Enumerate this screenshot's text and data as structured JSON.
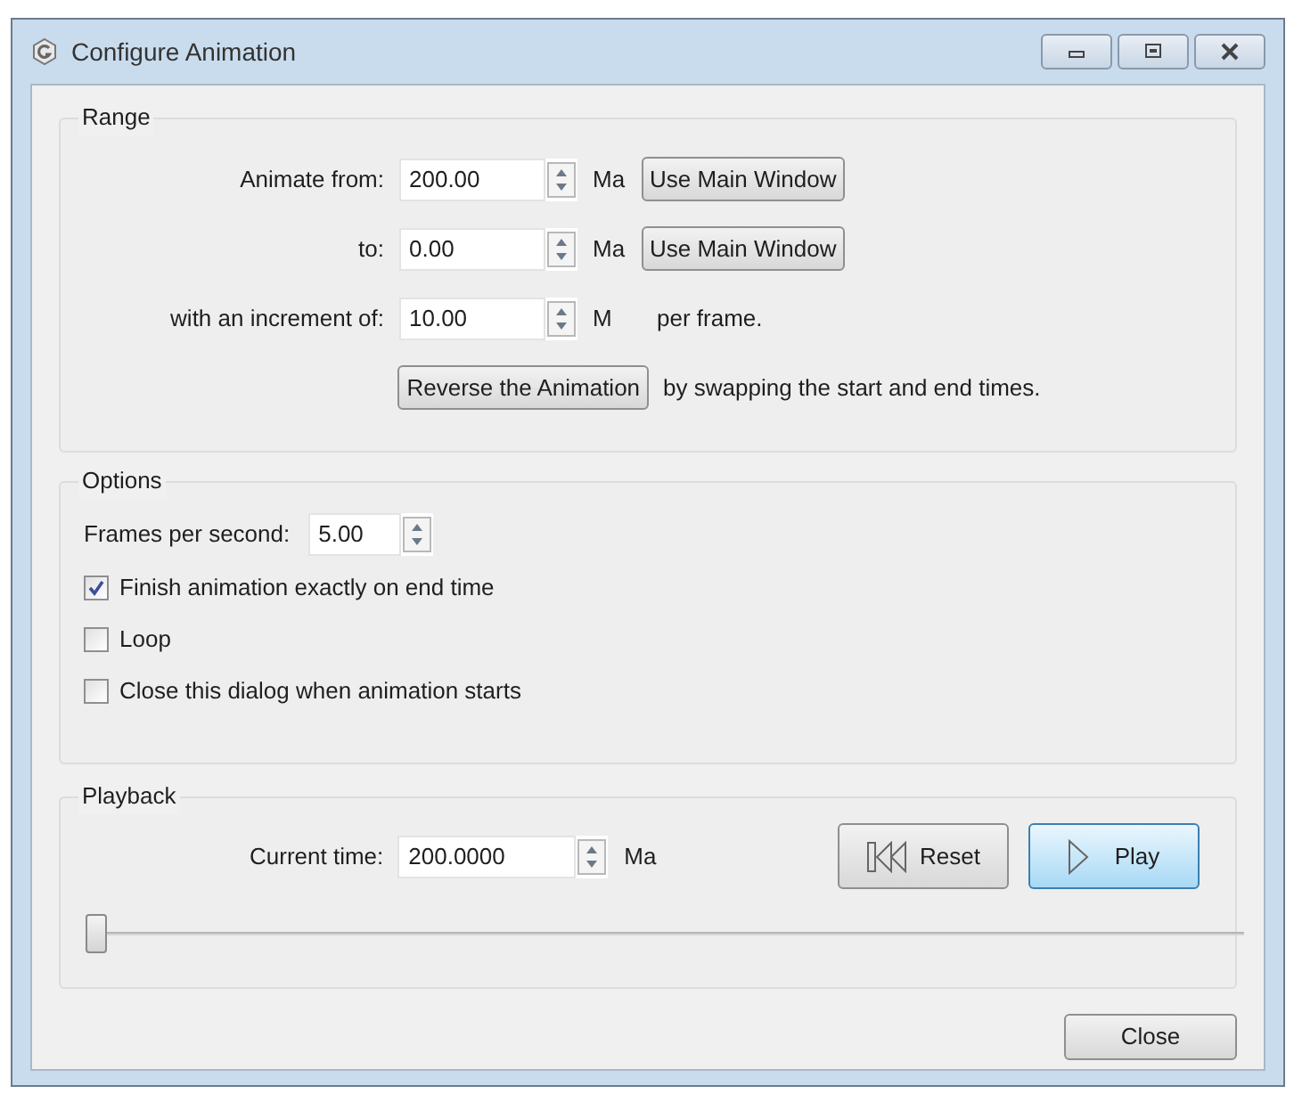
{
  "window": {
    "title": "Configure Animation"
  },
  "range": {
    "title": "Range",
    "rows": [
      {
        "label": "Animate from:",
        "value": "200.00",
        "unit": "Ma",
        "button": "Use Main Window"
      },
      {
        "label": "to:",
        "value": "0.00",
        "unit": "Ma",
        "button": "Use Main Window"
      },
      {
        "label": "with an increment of:",
        "value": "10.00",
        "unit": "M",
        "suffix": "per frame."
      }
    ],
    "reverse_button": "Reverse the Animation",
    "reverse_note": "by swapping the start and end times."
  },
  "options": {
    "title": "Options",
    "fps_label": "Frames per second:",
    "fps_value": "5.00",
    "checkboxes": [
      {
        "label": "Finish animation exactly on end time",
        "checked": true
      },
      {
        "label": "Loop",
        "checked": false
      },
      {
        "label": "Close this dialog when animation starts",
        "checked": false
      }
    ]
  },
  "playback": {
    "title": "Playback",
    "time_label": "Current time:",
    "time_value": "200.0000",
    "unit": "Ma",
    "reset_button": "Reset",
    "play_button": "Play",
    "slider": {
      "level": 0
    }
  },
  "close_button": "Close"
}
